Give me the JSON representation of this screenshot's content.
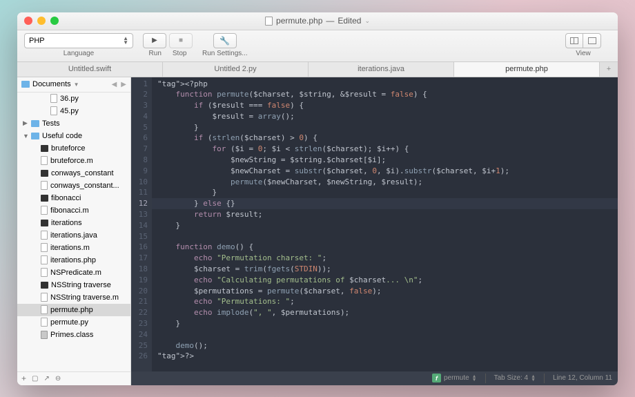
{
  "title": {
    "filename": "permute.php",
    "status": "Edited"
  },
  "toolbar": {
    "language": "PHP",
    "language_label": "Language",
    "run": "Run",
    "stop": "Stop",
    "run_settings": "Run Settings...",
    "view": "View"
  },
  "tabs": [
    {
      "label": "Untitled.swift",
      "active": false
    },
    {
      "label": "Untitled 2.py",
      "active": false
    },
    {
      "label": "iterations.java",
      "active": false
    },
    {
      "label": "permute.php",
      "active": true
    }
  ],
  "sidebar": {
    "root": "Documents",
    "items": [
      {
        "depth": 2,
        "icon": "file",
        "label": "36.py"
      },
      {
        "depth": 2,
        "icon": "file",
        "label": "45.py"
      },
      {
        "depth": 0,
        "icon": "folder",
        "label": "Tests",
        "disclosure": "▶"
      },
      {
        "depth": 0,
        "icon": "folder",
        "label": "Useful code",
        "disclosure": "▼"
      },
      {
        "depth": 1,
        "icon": "exec",
        "label": "bruteforce"
      },
      {
        "depth": 1,
        "icon": "file",
        "label": "bruteforce.m"
      },
      {
        "depth": 1,
        "icon": "exec",
        "label": "conways_constant"
      },
      {
        "depth": 1,
        "icon": "file",
        "label": "conways_constant..."
      },
      {
        "depth": 1,
        "icon": "exec",
        "label": "fibonacci"
      },
      {
        "depth": 1,
        "icon": "file",
        "label": "fibonacci.m"
      },
      {
        "depth": 1,
        "icon": "exec",
        "label": "iterations"
      },
      {
        "depth": 1,
        "icon": "file",
        "label": "iterations.java"
      },
      {
        "depth": 1,
        "icon": "file",
        "label": "iterations.m"
      },
      {
        "depth": 1,
        "icon": "file",
        "label": "iterations.php"
      },
      {
        "depth": 1,
        "icon": "file",
        "label": "NSPredicate.m"
      },
      {
        "depth": 1,
        "icon": "exec",
        "label": "NSString traverse"
      },
      {
        "depth": 1,
        "icon": "file",
        "label": "NSString traverse.m"
      },
      {
        "depth": 1,
        "icon": "file",
        "label": "permute.php",
        "selected": true
      },
      {
        "depth": 1,
        "icon": "file",
        "label": "permute.py"
      },
      {
        "depth": 1,
        "icon": "class",
        "label": "Primes.class"
      }
    ]
  },
  "editor": {
    "lines": 26,
    "current_line": 12,
    "code_raw": "<?php\n    function permute($charset, $string, &$result = false) {\n        if ($result === false) {\n            $result = array();\n        }\n        if (strlen($charset) > 0) {\n            for ($i = 0; $i < strlen($charset); $i++) {\n                $newString = $string.$charset[$i];\n                $newCharset = substr($charset, 0, $i).substr($charset, $i+1);\n                permute($newCharset, $newString, $result);\n            }\n        } else {}\n        return $result;\n    }\n\n    function demo() {\n        echo \"Permutation charset: \";\n        $charset = trim(fgets(STDIN));\n        echo \"Calculating permutations of $charset... \\n\";\n        $permutations = permute($charset, false);\n        echo \"Permutations: \";\n        echo implode(\", \", $permutations);\n    }\n\n    demo();\n?>"
  },
  "statusbar": {
    "symbol": "permute",
    "tab_size": "Tab Size: 4",
    "position": "Line 12, Column 11"
  }
}
